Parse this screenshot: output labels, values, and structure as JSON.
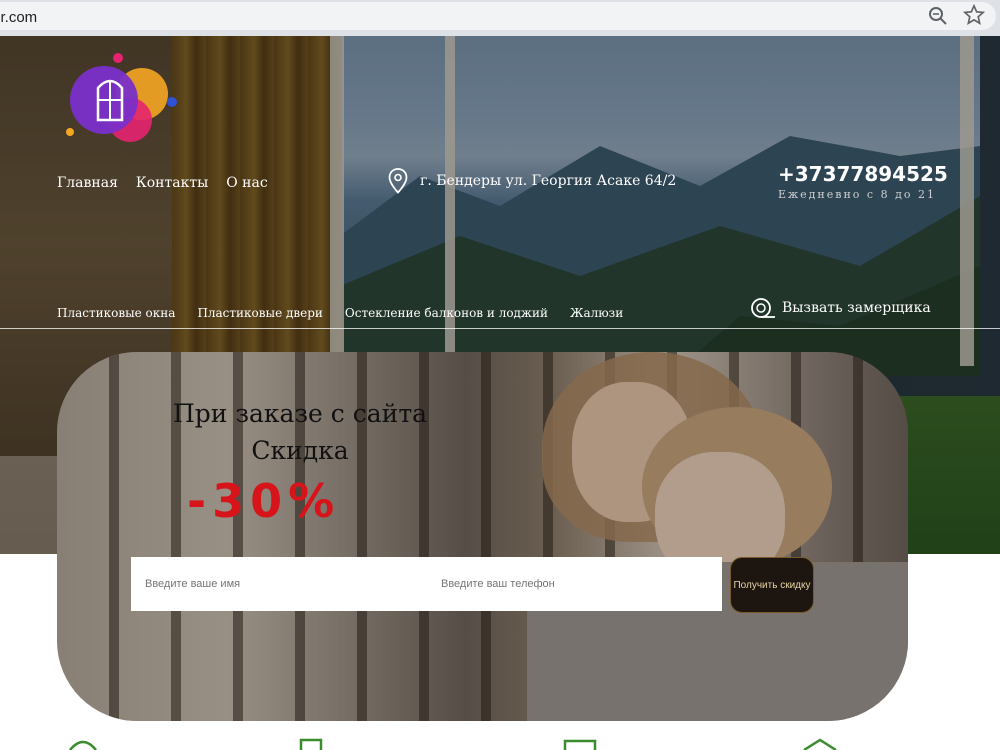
{
  "browser": {
    "url": "mr.com",
    "zoom_icon": "zoom-icon",
    "bookmark_icon": "star-icon"
  },
  "header": {
    "logo": "window-logo-icon",
    "nav": [
      "Главная",
      "Контакты",
      "О нас"
    ],
    "address": "г. Бендеры ул. Георгия Асаке 64/2",
    "phone": "+37377894525",
    "hours": "Ежедневно с 8 до 21",
    "services": [
      "Пластиковые окна",
      "Пластиковые двери",
      "Остекление балконов и лоджий",
      "Жалюзи"
    ],
    "call_measurer": "Вызвать замерщика"
  },
  "promo": {
    "line1": "При заказе с сайта",
    "line2": "Скидка",
    "discount": "-30%",
    "name_placeholder": "Введите ваше имя",
    "phone_placeholder": "Введите ваш телефон",
    "submit_label": "Получить скидку"
  },
  "colors": {
    "discount_red": "#d6141a",
    "button_dark": "#1c1510",
    "button_text": "#e9d5a8"
  }
}
